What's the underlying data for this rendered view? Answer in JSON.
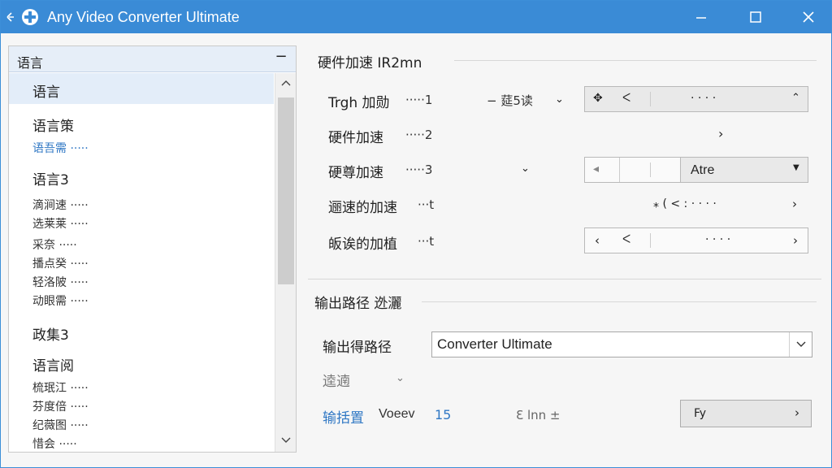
{
  "window": {
    "title": "Any Video Converter Ultimate",
    "controls": {
      "minimize": "—",
      "maximize": "☐",
      "close": "✕"
    }
  },
  "sidebar": {
    "header": "语言",
    "collapse": "−",
    "items": [
      {
        "label": "语言",
        "type": "group",
        "selected": true
      },
      {
        "label": "语言策",
        "type": "group"
      },
      {
        "label": "语吾需 ·····",
        "type": "link"
      },
      {
        "label": "语言3",
        "type": "group"
      },
      {
        "label": "滴涧速 ·····",
        "type": "sub"
      },
      {
        "label": "选莱莱 ·····",
        "type": "sub"
      },
      {
        "label": "采奈 ·····",
        "type": "sub"
      },
      {
        "label": "播点癸 ·····",
        "type": "sub"
      },
      {
        "label": "轻洛陂 ·····",
        "type": "sub"
      },
      {
        "label": "动眼需 ·····",
        "type": "sub"
      },
      {
        "label": "政集3",
        "type": "group"
      },
      {
        "label": "语言阅",
        "type": "group"
      },
      {
        "label": "梳珉江 ·····",
        "type": "sub"
      },
      {
        "label": "芬度倍 ·····",
        "type": "sub"
      },
      {
        "label": "纪薇图 ·····",
        "type": "sub"
      },
      {
        "label": "惜会 ·····",
        "type": "sub"
      }
    ]
  },
  "hardware": {
    "title": "硬件加速 IR2mn",
    "rows": [
      {
        "label": "Trgh 加勋",
        "dots": "·····1",
        "extra": "−   莚5读",
        "control_text": "· · · ·"
      },
      {
        "label": "硬件加速",
        "dots": "·····2",
        "control_text": ""
      },
      {
        "label": "硬尊加速",
        "dots": "·····3",
        "control_text": "Atre"
      },
      {
        "label": "逦速的加速",
        "dots": "···t",
        "control_text": "⁎ ( < : · · · ·"
      },
      {
        "label": "皈诶的加植",
        "dots": "···t",
        "control_text": "· · · ·"
      }
    ]
  },
  "output": {
    "title": "输出路径 迯灑",
    "path_label": "输出得路径",
    "path_value": "Converter Ultimate",
    "sub_label": "逵遖",
    "link_label": "输括置",
    "link_value": "Voeev",
    "link_number": "15",
    "misc_text": "Ɛ lnn ±",
    "button_label": "Fy"
  },
  "colors": {
    "titlebar": "#3a8bd6",
    "accent": "#2f77c4"
  }
}
